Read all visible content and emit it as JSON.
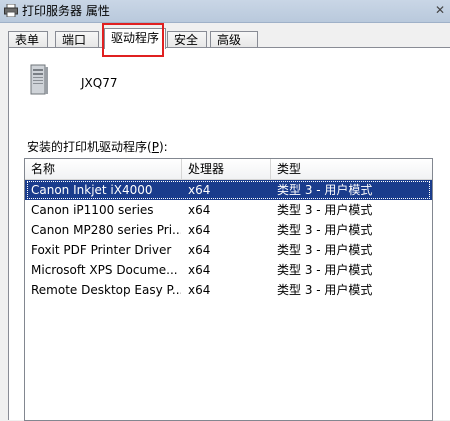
{
  "window": {
    "title": "打印服务器 属性",
    "close_glyph": "✕"
  },
  "tabs": [
    {
      "label": "表单",
      "active": false
    },
    {
      "label": "端口",
      "active": false
    },
    {
      "label": "驱动程序",
      "active": true
    },
    {
      "label": "安全",
      "active": false
    },
    {
      "label": "高级",
      "active": false
    }
  ],
  "server": {
    "icon": "server-computer-icon",
    "name": "JXQ77"
  },
  "drivers": {
    "label_prefix": "安装的打印机驱动程序(",
    "label_key": "P",
    "label_suffix": "):",
    "columns": [
      "名称",
      "处理器",
      "类型"
    ],
    "rows": [
      {
        "name": "Canon Inkjet iX4000",
        "processor": "x64",
        "type": "类型 3 - 用户模式",
        "selected": true
      },
      {
        "name": "Canon iP1100 series",
        "processor": "x64",
        "type": "类型 3 - 用户模式",
        "selected": false
      },
      {
        "name": "Canon MP280 series Pri...",
        "processor": "x64",
        "type": "类型 3 - 用户模式",
        "selected": false
      },
      {
        "name": "Foxit PDF Printer Driver",
        "processor": "x64",
        "type": "类型 3 - 用户模式",
        "selected": false
      },
      {
        "name": "Microsoft XPS Docume...",
        "processor": "x64",
        "type": "类型 3 - 用户模式",
        "selected": false
      },
      {
        "name": "Remote Desktop Easy P...",
        "processor": "x64",
        "type": "类型 3 - 用户模式",
        "selected": false
      }
    ]
  },
  "colors": {
    "selection": "#1a3c8c",
    "highlight_border": "#e02020"
  }
}
